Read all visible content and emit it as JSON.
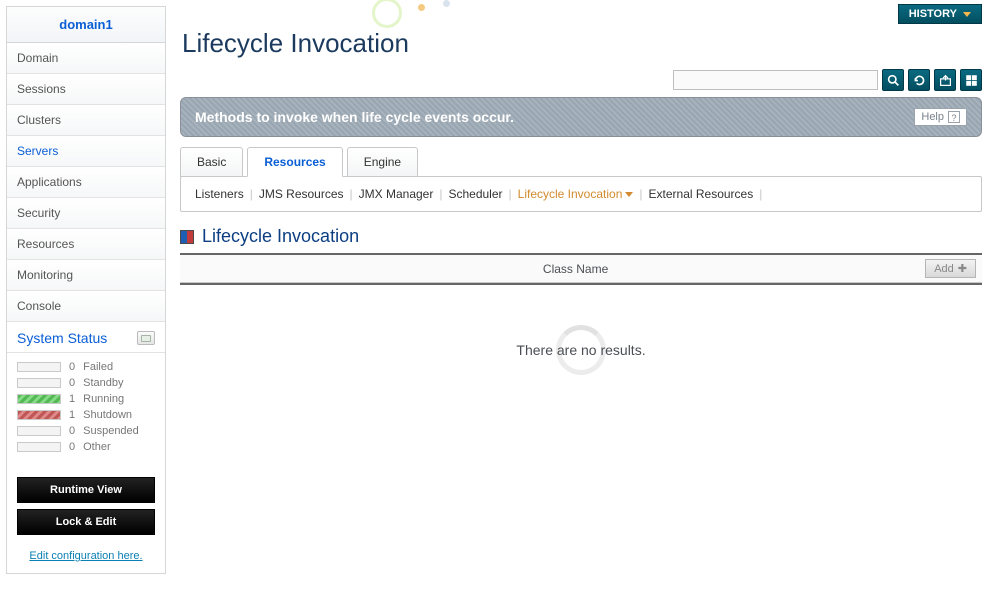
{
  "sidebar": {
    "domain": "domain1",
    "nav": [
      {
        "label": "Domain",
        "active": false
      },
      {
        "label": "Sessions",
        "active": false
      },
      {
        "label": "Clusters",
        "active": false
      },
      {
        "label": "Servers",
        "active": true
      },
      {
        "label": "Applications",
        "active": false
      },
      {
        "label": "Security",
        "active": false
      },
      {
        "label": "Resources",
        "active": false
      },
      {
        "label": "Monitoring",
        "active": false
      },
      {
        "label": "Console",
        "active": false
      }
    ],
    "system_status": {
      "title": "System Status",
      "items": [
        {
          "count": 0,
          "label": "Failed",
          "color": "none"
        },
        {
          "count": 0,
          "label": "Standby",
          "color": "none"
        },
        {
          "count": 1,
          "label": "Running",
          "color": "green"
        },
        {
          "count": 1,
          "label": "Shutdown",
          "color": "red"
        },
        {
          "count": 0,
          "label": "Suspended",
          "color": "none"
        },
        {
          "count": 0,
          "label": "Other",
          "color": "none"
        }
      ]
    },
    "buttons": {
      "runtime_view": "Runtime View",
      "lock_edit": "Lock & Edit"
    },
    "edit_link": "Edit configuration here."
  },
  "header": {
    "history_button": "HISTORY",
    "page_title": "Lifecycle Invocation",
    "search": {
      "value": "",
      "placeholder": ""
    },
    "icons": [
      "search-icon",
      "refresh-icon",
      "export-icon",
      "grid-icon"
    ]
  },
  "banner": {
    "text": "Methods to invoke when life cycle events occur.",
    "help_label": "Help"
  },
  "tabs": [
    {
      "label": "Basic",
      "active": false
    },
    {
      "label": "Resources",
      "active": true
    },
    {
      "label": "Engine",
      "active": false
    }
  ],
  "subnav": [
    {
      "label": "Listeners",
      "active": false
    },
    {
      "label": "JMS Resources",
      "active": false
    },
    {
      "label": "JMX Manager",
      "active": false
    },
    {
      "label": "Scheduler",
      "active": false
    },
    {
      "label": "Lifecycle Invocation",
      "active": true
    },
    {
      "label": "External Resources",
      "active": false
    }
  ],
  "section": {
    "title": "Lifecycle Invocation",
    "table": {
      "columns": [
        "Class Name"
      ],
      "rows": [],
      "add_label": "Add",
      "empty_message": "There are no results."
    }
  }
}
